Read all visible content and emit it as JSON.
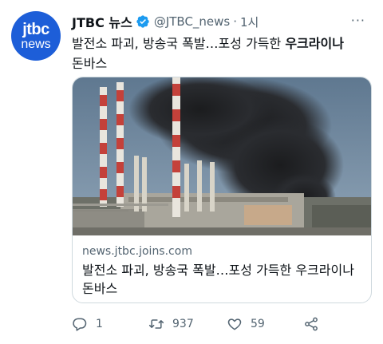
{
  "tweet": {
    "author_name": "JTBC 뉴스",
    "handle": "@JTBC_news",
    "separator": "·",
    "time": "1시",
    "more_label": "···",
    "text_part1": "발전소 파괴, 방송국 폭발…포성 가득한 ",
    "text_bold": "우크라이나",
    "text_part2": "돈바스",
    "avatar": {
      "brand": "jtbc",
      "sub": "news",
      "color": "#1d5ed8"
    }
  },
  "card": {
    "domain": "news.jtbc.joins.com",
    "title": "발전소 파괴, 방송국 폭발…포성 가득한 우크라이나 돈바스"
  },
  "actions": {
    "reply_count": "1",
    "retweet_count": "937",
    "like_count": "59"
  },
  "icons": [
    "verified-icon",
    "more-icon",
    "reply-icon",
    "retweet-icon",
    "like-icon",
    "share-icon"
  ],
  "colors": {
    "verified": "#1d9bf0",
    "secondary_text": "#536471",
    "border": "#cfd9de"
  }
}
